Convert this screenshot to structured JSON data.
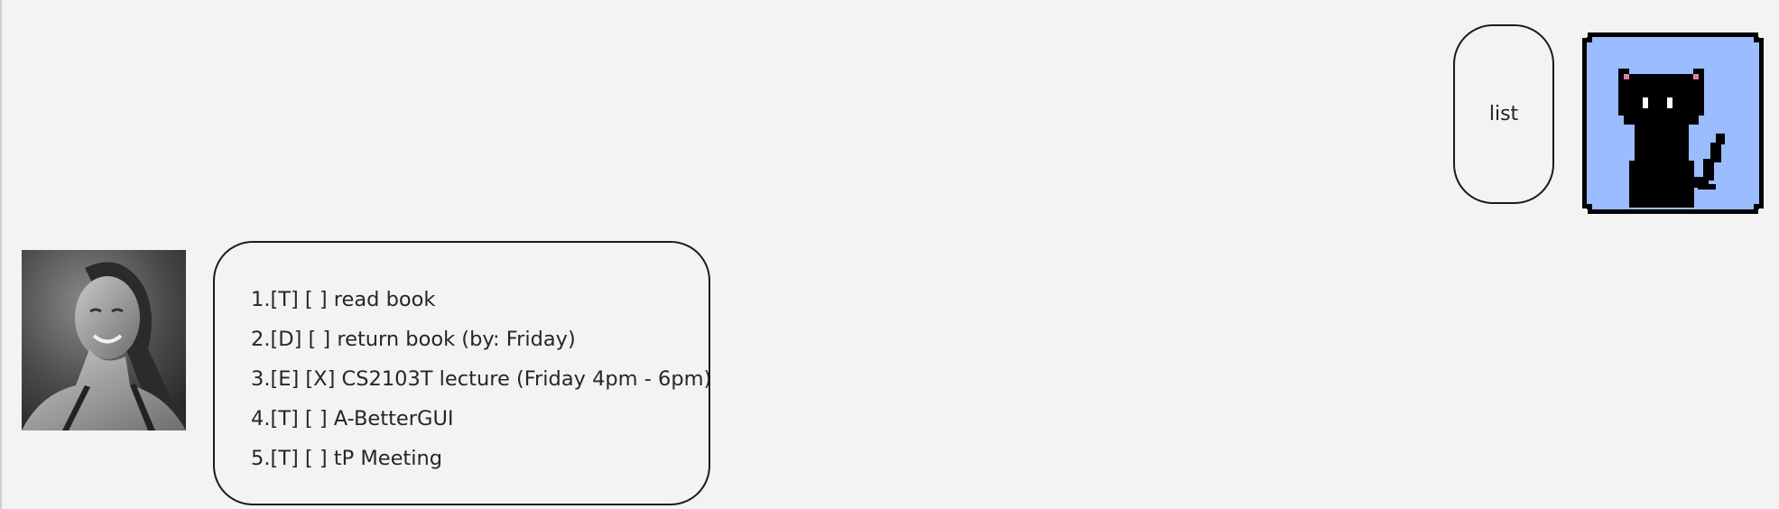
{
  "user_message": {
    "text": "list"
  },
  "bot_message": {
    "lines": [
      "1.[T] [ ] read book",
      "2.[D] [ ] return book (by: Friday)",
      "3.[E] [X] CS2103T lecture (Friday 4pm - 6pm)",
      "4.[T] [ ] A-BetterGUI",
      "5.[T] [ ] tP Meeting"
    ]
  },
  "avatars": {
    "user": "pixel-black-cat-avatar",
    "bot": "grayscale-photo-avatar"
  },
  "colors": {
    "background": "#f3f3f3",
    "bubble_border": "#1a1a1a",
    "cat_background": "#9bbcff",
    "cat_body": "#000000",
    "cat_ear_inner": "#e07cb0"
  }
}
